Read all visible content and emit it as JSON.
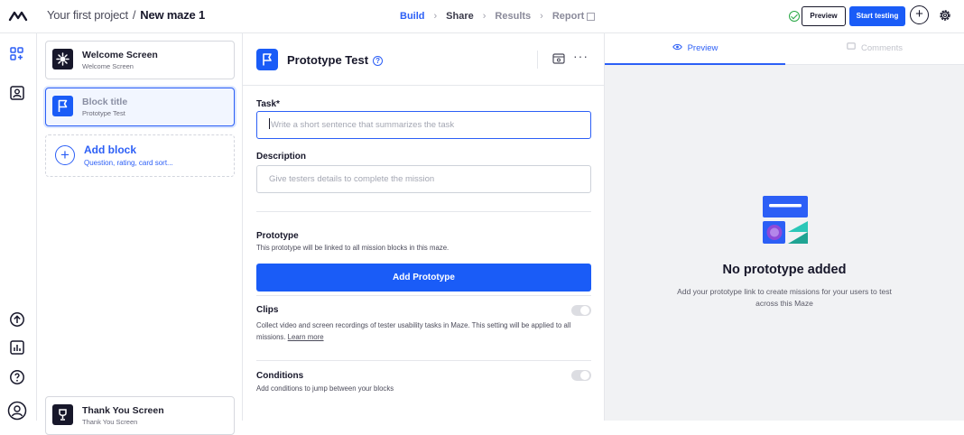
{
  "breadcrumb": {
    "project": "Your first project",
    "separator": "/",
    "maze": "New maze 1"
  },
  "steps": [
    {
      "label": "Build"
    },
    {
      "label": "Share"
    },
    {
      "label": "Results"
    },
    {
      "label": "Report"
    }
  ],
  "header_actions": {
    "preview_label": "Preview",
    "start_label": "Start testing",
    "add_symbol": "+"
  },
  "blocks": {
    "welcome": {
      "title": "Welcome Screen",
      "subtitle": "Welcome Screen"
    },
    "current": {
      "title": "Block title",
      "subtitle": "Prototype Test"
    },
    "add": {
      "title": "Add block",
      "subtitle": "Question, rating, card sort..."
    },
    "thankyou": {
      "title": "Thank You Screen",
      "subtitle": "Thank You Screen"
    }
  },
  "editor": {
    "title": "Prototype Test",
    "more": "···",
    "task_label": "Task*",
    "task_placeholder": "Write a short sentence that summarizes the task",
    "description_label": "Description",
    "description_placeholder": "Give testers details to complete the mission",
    "prototype_label": "Prototype",
    "prototype_sub": "This prototype will be linked to all mission blocks in this maze.",
    "add_prototype": "Add Prototype",
    "clips_label": "Clips",
    "clips_sub": "Collect video and screen recordings of tester usability tasks in Maze. This setting will be applied to all missions.",
    "learn_more": "Learn more",
    "conditions_label": "Conditions",
    "conditions_sub": "Add conditions to jump between your blocks"
  },
  "preview_panel": {
    "tab_preview": "Preview",
    "tab_comments": "Comments",
    "empty_title": "No prototype added",
    "empty_desc": "Add your prototype link to create missions for your users to test across this Maze"
  },
  "colors": {
    "accent": "#1a5cf7",
    "success": "#28a745"
  }
}
